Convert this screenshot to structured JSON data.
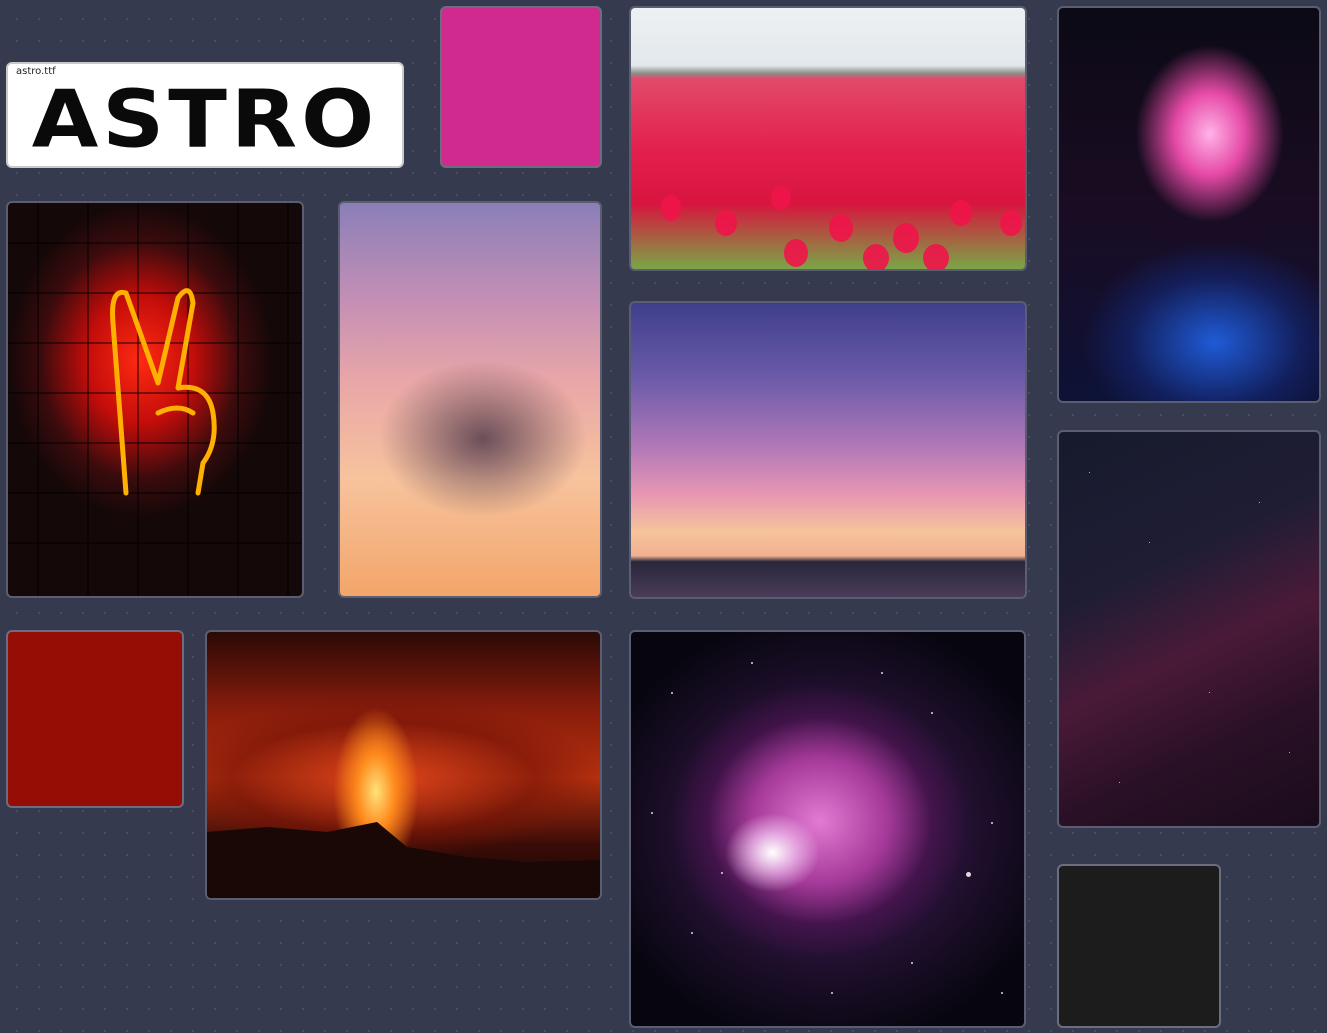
{
  "font_card": {
    "filename": "astro.ttf",
    "sample_text": "ASTRO"
  },
  "swatches": [
    {
      "name": "magenta",
      "color": "#d12a8e"
    },
    {
      "name": "red",
      "color": "#960d06"
    },
    {
      "name": "black",
      "color": "#1c1c1c"
    }
  ],
  "images": [
    {
      "name": "tulip-field"
    },
    {
      "name": "concert-crowd-smoke"
    },
    {
      "name": "neon-peace-sign"
    },
    {
      "name": "sunset-clouds"
    },
    {
      "name": "twilight-horizon"
    },
    {
      "name": "volcano-eruption"
    },
    {
      "name": "orion-nebula"
    },
    {
      "name": "night-sky"
    }
  ]
}
